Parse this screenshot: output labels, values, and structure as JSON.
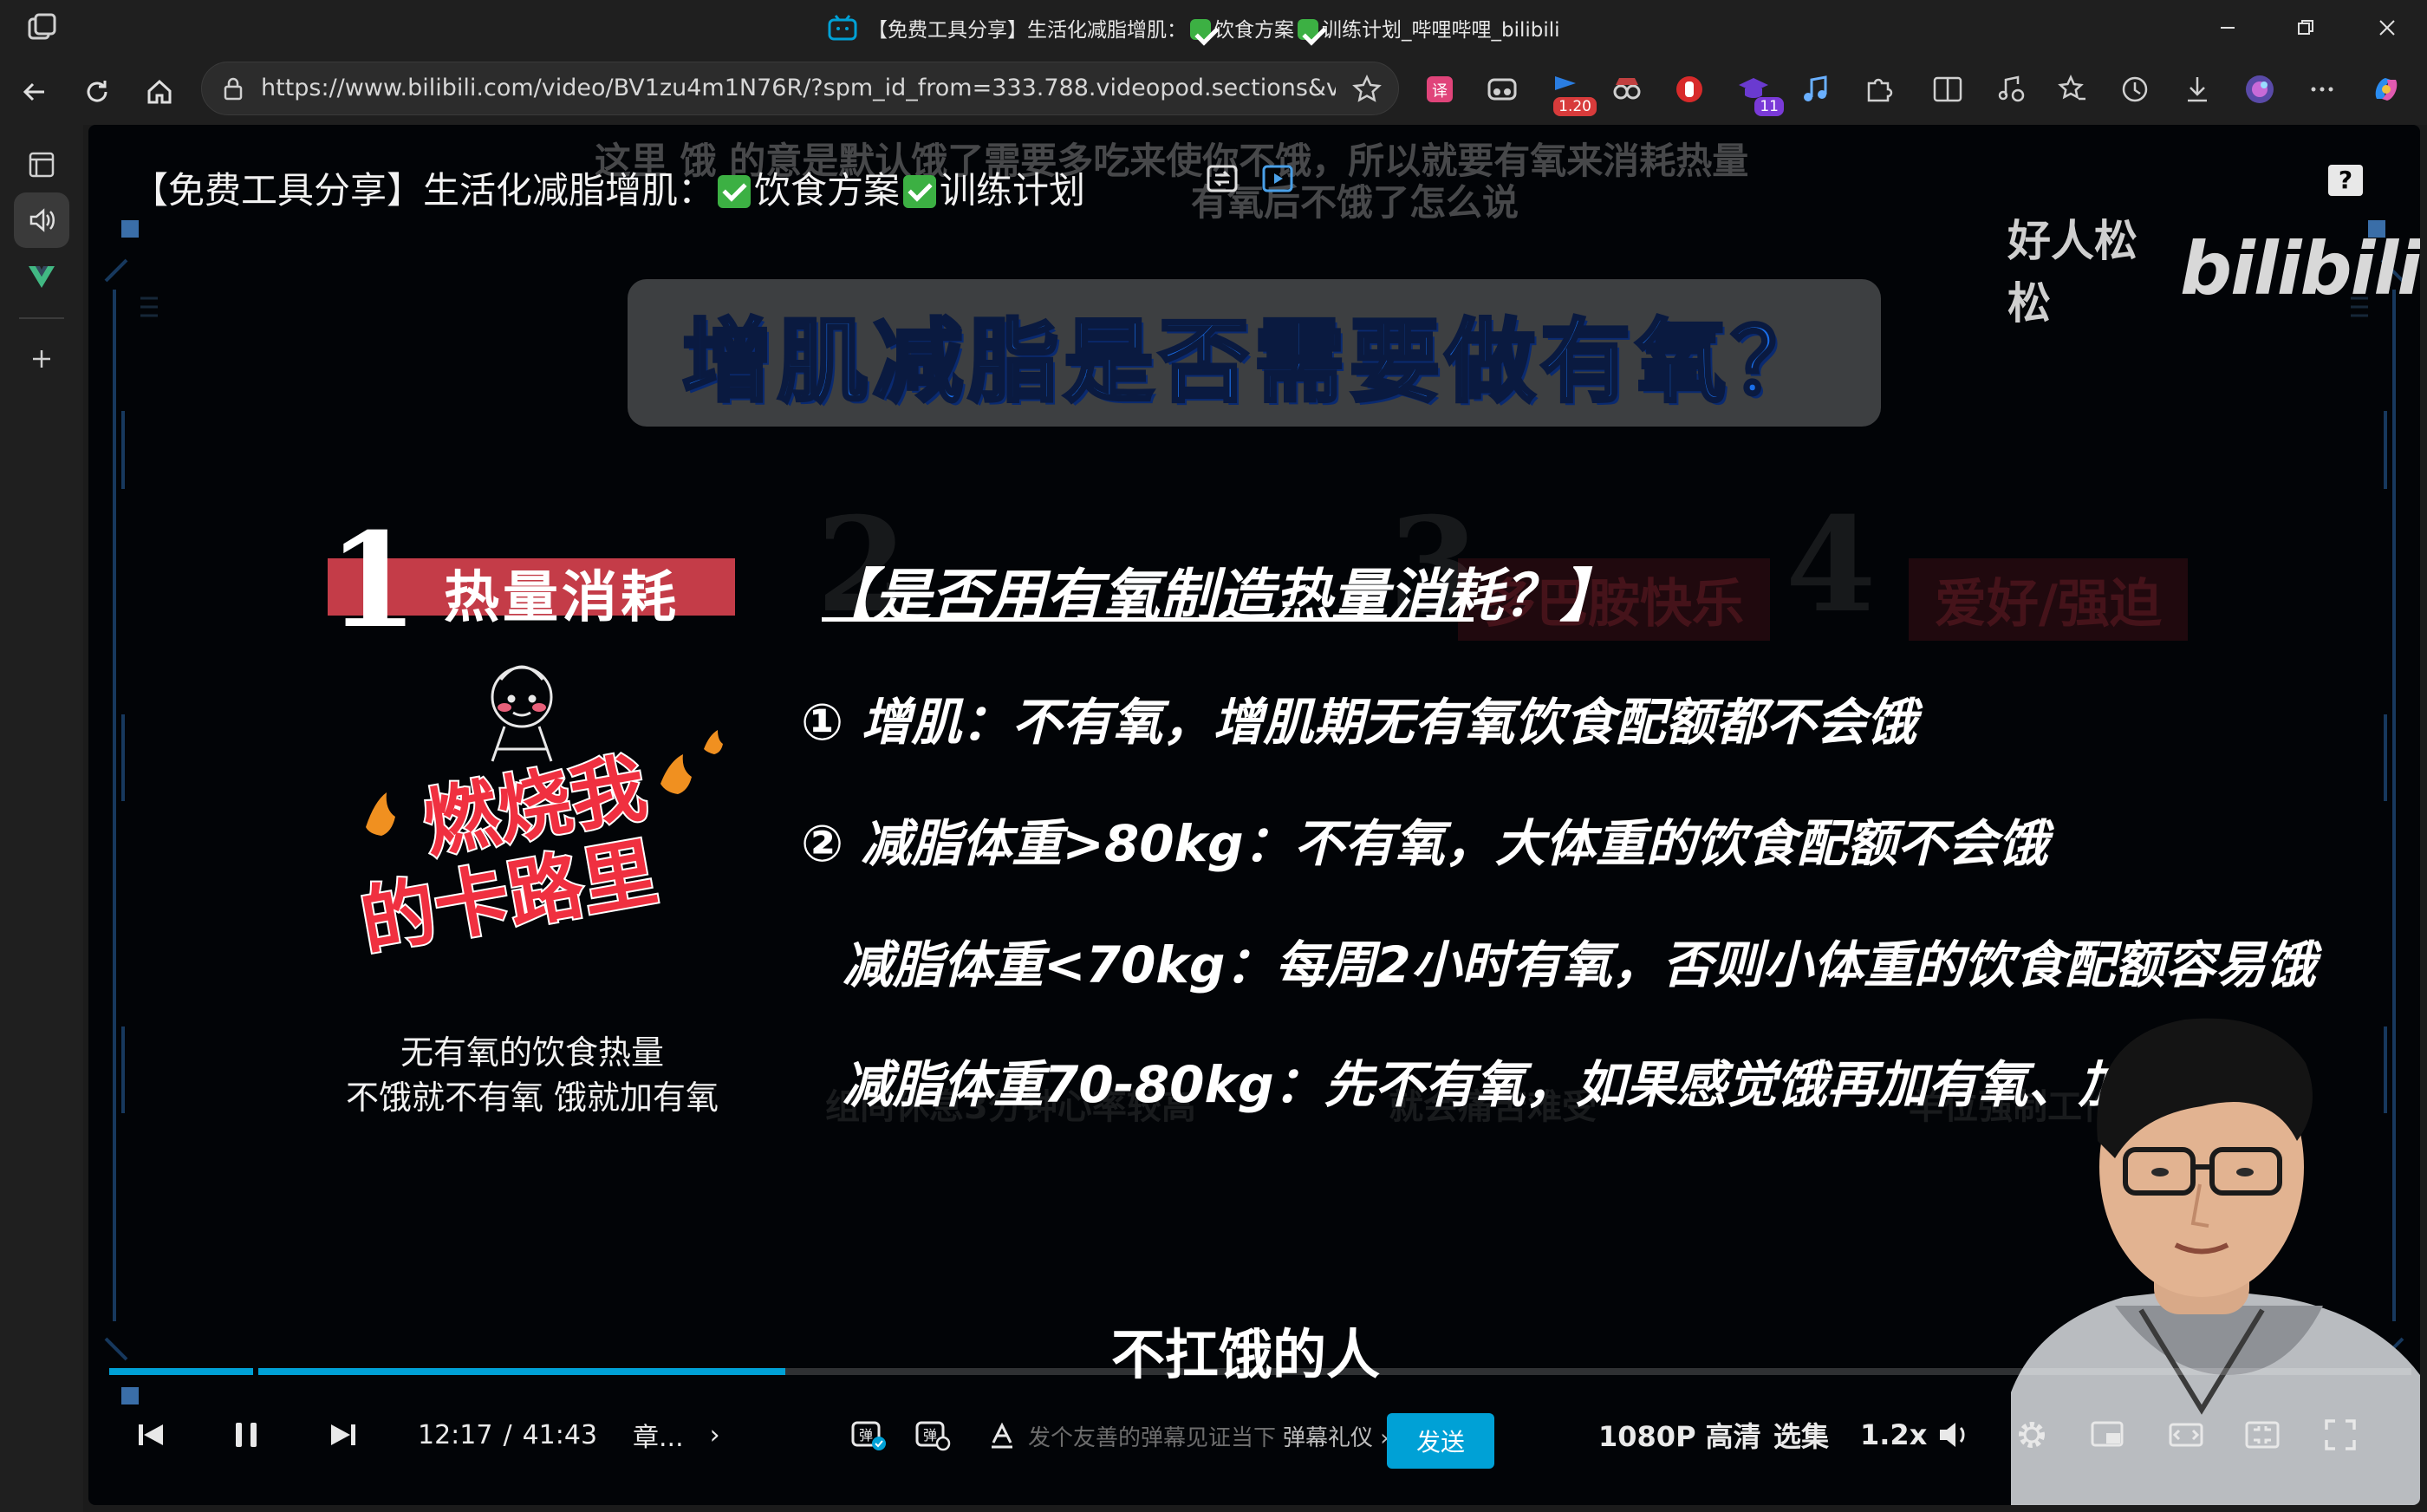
{
  "window": {
    "title": "【免费工具分享】生活化减脂增肌：✅饮食方案✅训练计划_哔哩哔哩_bilibili",
    "title_prefix": "【免费工具分享】生活化减脂增肌：",
    "title_part2": "饮食方案",
    "title_part3": "训练计划_哔哩哔哩_bilibili"
  },
  "browser": {
    "url": "https://www.bilibili.com/video/BV1zu4m1N76R/?spm_id_from=333.788.videopod.sections&vd_sou...",
    "extension_badge_1": "1.20",
    "extension_badge_2": "11"
  },
  "video": {
    "overlay_title_prefix": "【免费工具分享】生活化减脂增肌：",
    "overlay_title_part2": "饮食方案",
    "overlay_title_part3": "训练计划",
    "danmaku_1": "这里 饿 的意是默认饿了需要多吃来使你不饿，所以就要有氧来消耗热量",
    "danmaku_2": "有氧后不饿了怎么说",
    "help_badge": "?",
    "watermark_name": "好人松松",
    "watermark_logo": "bilibili",
    "headline": "增肌减脂是否需要做有氧？",
    "section_number": "1",
    "section_label": "热量消耗",
    "faint_sections": [
      "2",
      "多巴胺快乐",
      "3",
      "4",
      "爱好/强迫"
    ],
    "question_title": "【是否用有氧制造热量消耗？】",
    "lines": [
      "① 增肌：不有氧，增肌期无有氧饮食配额都不会饿",
      "② 减脂体重>80kg：不有氧，大体重的饮食配额不会饿",
      "减脂体重<70kg：每周2小时有氧，否则小体重的饮食配额容易饿",
      "减脂体重70-80kg：先不有氧，如果感觉饿再加有氧、加饮食量"
    ],
    "sticker_text_1": "燃烧我",
    "sticker_text_2": "的卡路里",
    "note_line_1": "无有氧的饮食热量",
    "note_line_2": "不饿就不有氧 饿就加有氧",
    "faint_bg_1": "组间休息3分钟心率较高",
    "faint_bg_2": "就会痛苦难受",
    "faint_bg_3": "羊位强制工作需要",
    "subtitle": "不扛饿的人",
    "progress_fraction": 0.2937,
    "current_time": "12:17",
    "time_separator": "/",
    "total_time": "41:43"
  },
  "controls": {
    "chapter_label": "章...",
    "chapter_arrow": "›",
    "danmu_placeholder": "发个友善的弹幕见证当下",
    "danmu_etiquette": "弹幕礼仪 ›",
    "send_label": "发送",
    "quality_label": "1080P 高清",
    "episodes_label": "选集",
    "speed_label": "1.2x"
  },
  "colors": {
    "accent": "#00a1d6",
    "headline_blue": "#1a6ee8",
    "section_red": "#c43c48",
    "check_green": "#3cb043"
  }
}
